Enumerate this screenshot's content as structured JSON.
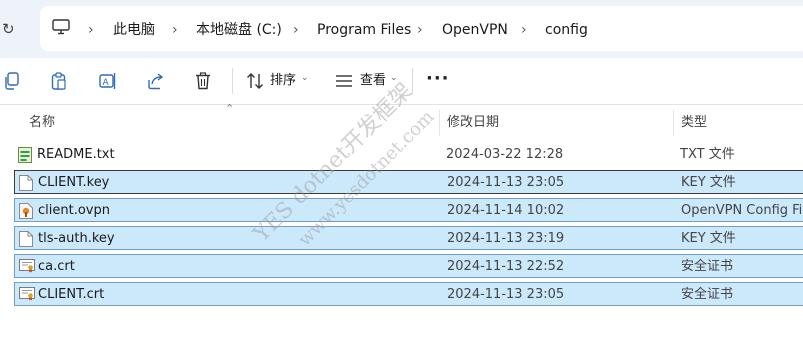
{
  "breadcrumb": {
    "items": [
      "此电脑",
      "本地磁盘 (C:)",
      "Program Files",
      "OpenVPN",
      "config"
    ]
  },
  "toolbar": {
    "sort_label": "排序",
    "view_label": "查看",
    "more_label": "···"
  },
  "columns": {
    "name": "名称",
    "modified": "修改日期",
    "type": "类型"
  },
  "files": [
    {
      "name": "README.txt",
      "modified": "2024-03-22 12:28",
      "type": "TXT 文件",
      "icon": "text-file-icon",
      "selected": false
    },
    {
      "name": "CLIENT.key",
      "modified": "2024-11-13 23:05",
      "type": "KEY 文件",
      "icon": "blank-file-icon",
      "selected": true
    },
    {
      "name": "client.ovpn",
      "modified": "2024-11-14 10:02",
      "type": "OpenVPN Config File",
      "icon": "ovpn-file-icon",
      "selected": true
    },
    {
      "name": "tls-auth.key",
      "modified": "2024-11-13 23:19",
      "type": "KEY 文件",
      "icon": "blank-file-icon",
      "selected": true
    },
    {
      "name": "ca.crt",
      "modified": "2024-11-13 22:52",
      "type": "安全证书",
      "icon": "certificate-file-icon",
      "selected": true
    },
    {
      "name": "CLIENT.crt",
      "modified": "2024-11-13 23:05",
      "type": "安全证书",
      "icon": "certificate-file-icon",
      "selected": true
    }
  ],
  "watermark": {
    "line1": "YES dotnet开发框架",
    "line2": "www.yesdotnet.com"
  },
  "colors": {
    "selection_fill": "#cce8fb",
    "selection_border": "#6f9ec9",
    "address_bg": "#eef3f9"
  }
}
